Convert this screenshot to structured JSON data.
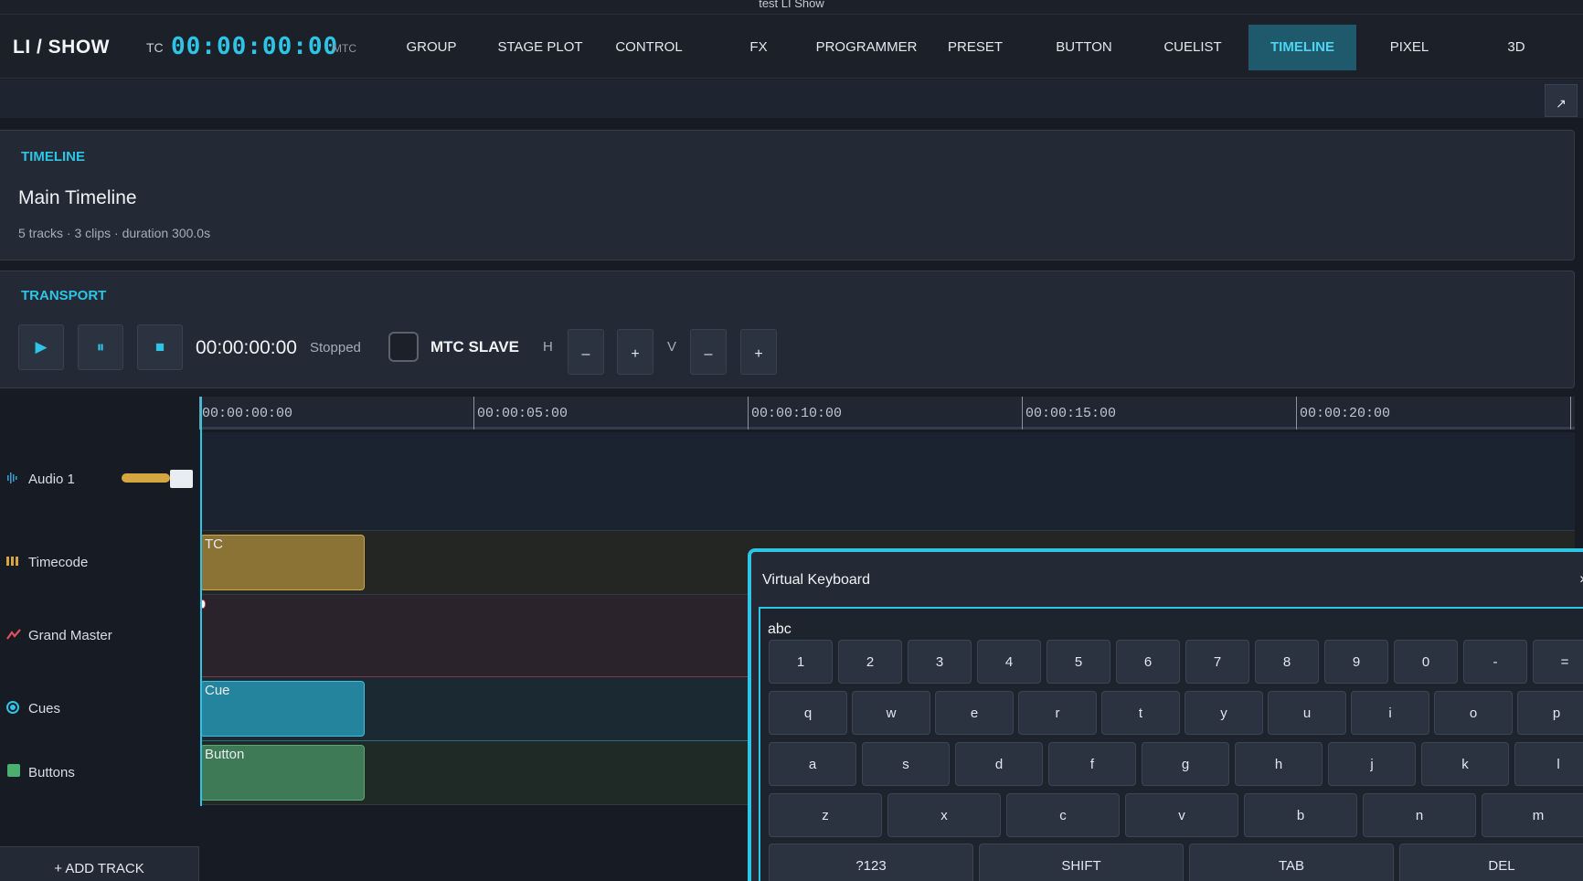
{
  "window": {
    "title": "test LI Show"
  },
  "header": {
    "logo": "LI / SHOW",
    "tc_label": "TC",
    "tc_value": "00:00:00:00",
    "mtc_label": "MTC",
    "tabs": [
      {
        "label": "GROUP"
      },
      {
        "label": "STAGE PLOT"
      },
      {
        "label": "CONTROL"
      },
      {
        "label": "FX"
      },
      {
        "label": "PROGRAMMER"
      },
      {
        "label": "PRESET"
      },
      {
        "label": "BUTTON"
      },
      {
        "label": "CUELIST"
      },
      {
        "label": "TIMELINE",
        "active": true
      },
      {
        "label": "PIXEL"
      },
      {
        "label": "3D"
      }
    ]
  },
  "toolbar": {
    "expand_icon": "↗"
  },
  "timeline_panel": {
    "heading": "TIMELINE",
    "name": "Main Timeline",
    "meta": "5 tracks · 3 clips · duration 300.0s"
  },
  "transport": {
    "heading": "TRANSPORT",
    "play_icon": "▶",
    "pause_icon": "⏸",
    "stop_icon": "■",
    "time": "00:00:00:00",
    "status": "Stopped",
    "mtc_slave_label": "MTC SLAVE",
    "mtc_slave_checked": false,
    "h_label": "H",
    "v_label": "V",
    "minus": "–",
    "plus": "+"
  },
  "ruler": {
    "ticks": [
      "00:00:00:00",
      "00:00:05:00",
      "00:00:10:00",
      "00:00:15:00",
      "00:00:20:00"
    ]
  },
  "tracks": [
    {
      "name": "Audio 1",
      "icon": "audio-wave-icon",
      "color": "#3a9fd6",
      "volume_fraction": 0.7
    },
    {
      "name": "Timecode",
      "icon": "timecode-bars-icon",
      "color": "#d4a640"
    },
    {
      "name": "Grand Master",
      "icon": "grand-master-icon",
      "color": "#e0505a"
    },
    {
      "name": "Cues",
      "icon": "cue-dot-icon",
      "color": "#2ec4e6"
    },
    {
      "name": "Buttons",
      "icon": "button-square-icon",
      "color": "#4caf6e"
    }
  ],
  "clips": [
    {
      "label": "TC",
      "track": "Timecode",
      "color": "#8b7235"
    },
    {
      "label": "Cue",
      "track": "Cues",
      "color": "#24849e"
    },
    {
      "label": "Button",
      "track": "Buttons",
      "color": "#3d7a55"
    }
  ],
  "add_track_label": "+ ADD TRACK",
  "virtual_keyboard": {
    "title": "Virtual Keyboard",
    "close_icon": "×",
    "mode": "abc",
    "row1": [
      "1",
      "2",
      "3",
      "4",
      "5",
      "6",
      "7",
      "8",
      "9",
      "0",
      "-",
      "="
    ],
    "row2": [
      "q",
      "w",
      "e",
      "r",
      "t",
      "y",
      "u",
      "i",
      "o",
      "p"
    ],
    "row3": [
      "a",
      "s",
      "d",
      "f",
      "g",
      "h",
      "j",
      "k",
      "l"
    ],
    "row4": [
      "z",
      "x",
      "c",
      "v",
      "b",
      "n",
      "m"
    ],
    "row5": [
      "?123",
      "SHIFT",
      "TAB",
      "DEL"
    ]
  }
}
